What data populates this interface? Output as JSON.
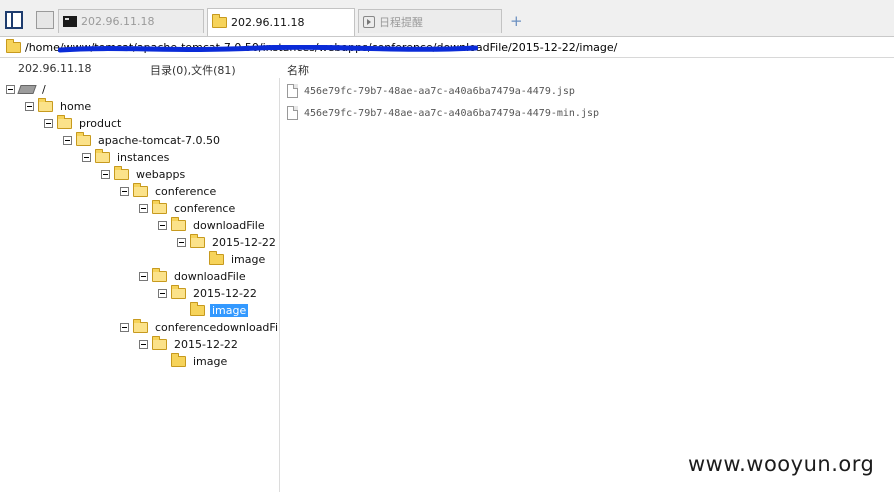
{
  "tabs": {
    "items": [
      {
        "label": "202.96.11.18",
        "icon": "terminal-icon",
        "active": false
      },
      {
        "label": "202.96.11.18",
        "icon": "folder-icon",
        "active": true
      },
      {
        "label": "日程提醒",
        "icon": "calendar-icon",
        "active": false
      }
    ],
    "add_label": "+"
  },
  "path_bar": {
    "value": "/home/www/tomcat/apache-tomcat-7.0.50/instances/webapps/conference/downloadFile/2015-12-22/image/"
  },
  "header": {
    "host": "202.96.11.18",
    "dir_file_count": "目录(0),文件(81)",
    "name_column": "名称"
  },
  "tree": [
    {
      "label": "/",
      "type": "drive",
      "depth": 0,
      "toggle": true
    },
    {
      "label": "home",
      "type": "folder",
      "depth": 1,
      "toggle": true
    },
    {
      "label": "product",
      "type": "folder",
      "depth": 2,
      "toggle": true
    },
    {
      "label": "apache-tomcat-7.0.50",
      "type": "folder",
      "depth": 3,
      "toggle": true
    },
    {
      "label": "instances",
      "type": "folder",
      "depth": 4,
      "toggle": true
    },
    {
      "label": "webapps",
      "type": "folder",
      "depth": 5,
      "toggle": true
    },
    {
      "label": "conference",
      "type": "folder",
      "depth": 6,
      "toggle": true
    },
    {
      "label": "conference",
      "type": "folder",
      "depth": 7,
      "toggle": true
    },
    {
      "label": "downloadFile",
      "type": "folder",
      "depth": 8,
      "toggle": true
    },
    {
      "label": "2015-12-22",
      "type": "folder",
      "depth": 9,
      "toggle": true
    },
    {
      "label": "image",
      "type": "folder",
      "depth": 10,
      "toggle": false
    },
    {
      "label": "downloadFile",
      "type": "folder",
      "depth": 7,
      "toggle": true
    },
    {
      "label": "2015-12-22",
      "type": "folder",
      "depth": 8,
      "toggle": true
    },
    {
      "label": "image",
      "type": "folder",
      "depth": 9,
      "toggle": false,
      "selected": true
    },
    {
      "label": "conferencedownloadFile",
      "type": "folder",
      "depth": 6,
      "toggle": true
    },
    {
      "label": "2015-12-22",
      "type": "folder",
      "depth": 7,
      "toggle": true
    },
    {
      "label": "image",
      "type": "folder",
      "depth": 8,
      "toggle": false
    }
  ],
  "files": [
    {
      "name": "456e79fc-79b7-48ae-aa7c-a40a6ba7479a-4479.jsp"
    },
    {
      "name": "456e79fc-79b7-48ae-aa7c-a40a6ba7479a-4479-min.jsp"
    }
  ],
  "watermark": "www.wooyun.org",
  "colors": {
    "selection": "#3399ff",
    "folder": "#f6d35a",
    "redaction": "#0a2bd8"
  }
}
